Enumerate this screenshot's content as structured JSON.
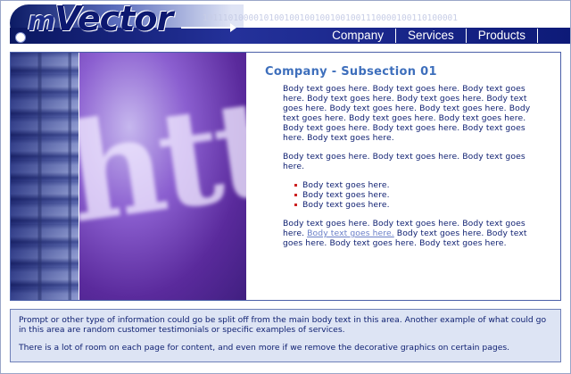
{
  "header": {
    "logo_prefix": "m",
    "logo_word": "Vector",
    "binary_strip": "10111010000101001001001001001001110000100110100001",
    "nav": [
      "Company",
      "Services",
      "Products"
    ]
  },
  "main": {
    "heading": "Company - Subsection 01",
    "image_text": "http",
    "paragraph_1": "Body text goes here. Body text goes here. Body text goes here. Body text goes here. Body text goes here. Body text goes here. Body text goes here. Body text goes here. Body text goes here. Body text goes here. Body text goes here. Body text goes here. Body text goes here. Body text goes here. Body text goes here.",
    "paragraph_2": "Body text goes here. Body text goes here. Body text goes here.",
    "bullets": [
      "Body text goes here.",
      "Body text goes here.",
      "Body text goes here."
    ],
    "paragraph_3_before": "Body text goes here. Body text goes here. Body text goes here. ",
    "paragraph_3_link": "Body text goes here.",
    "paragraph_3_after": " Body text goes here. Body text goes here. Body text goes here. Body text goes here."
  },
  "note": {
    "line_1": "Prompt or other type of information could go be split off from the main body text in this area.   Another example of what could go in this area are random customer testimonials or specific examples of services.",
    "line_2": "There is a lot of room on each page for content, and even more if we remove the decorative graphics on certain pages."
  },
  "colors": {
    "header_bar": "#0d1a78",
    "heading": "#3e6fbc",
    "body_text": "#0d1e70",
    "note_bg": "#dde4f4",
    "bullet": "#cc2222"
  }
}
